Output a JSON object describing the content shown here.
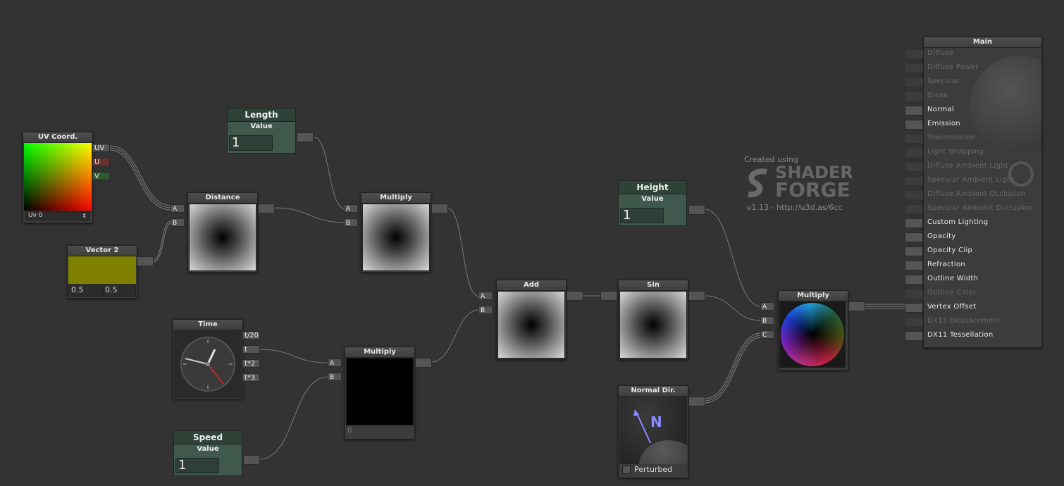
{
  "watermark": {
    "created": "Created using",
    "logo_line1": "SHADER",
    "logo_line2": "FORGE",
    "version": "v1.13 - http://u3d.as/6cc"
  },
  "nodes": {
    "uv": {
      "title": "UV Coord.",
      "out_uv": "UV",
      "out_u": "U",
      "out_v": "V",
      "channel": "Uv 0"
    },
    "vector2": {
      "title": "Vector 2",
      "x": "0.5",
      "y": "0.5",
      "color": "#808000"
    },
    "length": {
      "title": "Length",
      "sub": "Value",
      "value": "1"
    },
    "distance": {
      "title": "Distance",
      "a": "A",
      "b": "B"
    },
    "multiply1": {
      "title": "Multiply",
      "a": "A",
      "b": "B"
    },
    "time": {
      "title": "Time",
      "o1": "t/20",
      "o2": "t",
      "o3": "t*2",
      "o4": "t*3"
    },
    "speed": {
      "title": "Speed",
      "sub": "Value",
      "value": "1"
    },
    "multiply2": {
      "title": "Multiply",
      "a": "A",
      "b": "B",
      "value": "0"
    },
    "add": {
      "title": "Add",
      "a": "A",
      "b": "B"
    },
    "sin": {
      "title": "Sin"
    },
    "height": {
      "title": "Height",
      "sub": "Value",
      "value": "1"
    },
    "normaldir": {
      "title": "Normal Dir.",
      "glyph": "N",
      "perturbed": "Perturbed"
    },
    "multiply3": {
      "title": "Multiply",
      "a": "A",
      "b": "B",
      "c": "C"
    }
  },
  "main": {
    "title": "Main",
    "inputs": [
      {
        "label": "Diffuse",
        "enabled": false
      },
      {
        "label": "Diffuse Power",
        "enabled": false
      },
      {
        "label": "Specular",
        "enabled": false
      },
      {
        "label": "Gloss",
        "enabled": false
      },
      {
        "label": "Normal",
        "enabled": true
      },
      {
        "label": "Emission",
        "enabled": true
      },
      {
        "label": "Transmission",
        "enabled": false
      },
      {
        "label": "Light Wrapping",
        "enabled": false
      },
      {
        "label": "Diffuse Ambient Light",
        "enabled": false
      },
      {
        "label": "Specular Ambient Light",
        "enabled": false
      },
      {
        "label": "Diffuse Ambient Occlusion",
        "enabled": false
      },
      {
        "label": "Specular Ambient Occlusion",
        "enabled": false
      },
      {
        "label": "Custom Lighting",
        "enabled": true
      },
      {
        "label": "Opacity",
        "enabled": true
      },
      {
        "label": "Opacity Clip",
        "enabled": true
      },
      {
        "label": "Refraction",
        "enabled": true
      },
      {
        "label": "Outline Width",
        "enabled": true
      },
      {
        "label": "Outline Color",
        "enabled": false
      },
      {
        "label": "Vertex Offset",
        "enabled": true
      },
      {
        "label": "DX11 Displacement",
        "enabled": false
      },
      {
        "label": "DX11 Tessellation",
        "enabled": true
      }
    ]
  }
}
